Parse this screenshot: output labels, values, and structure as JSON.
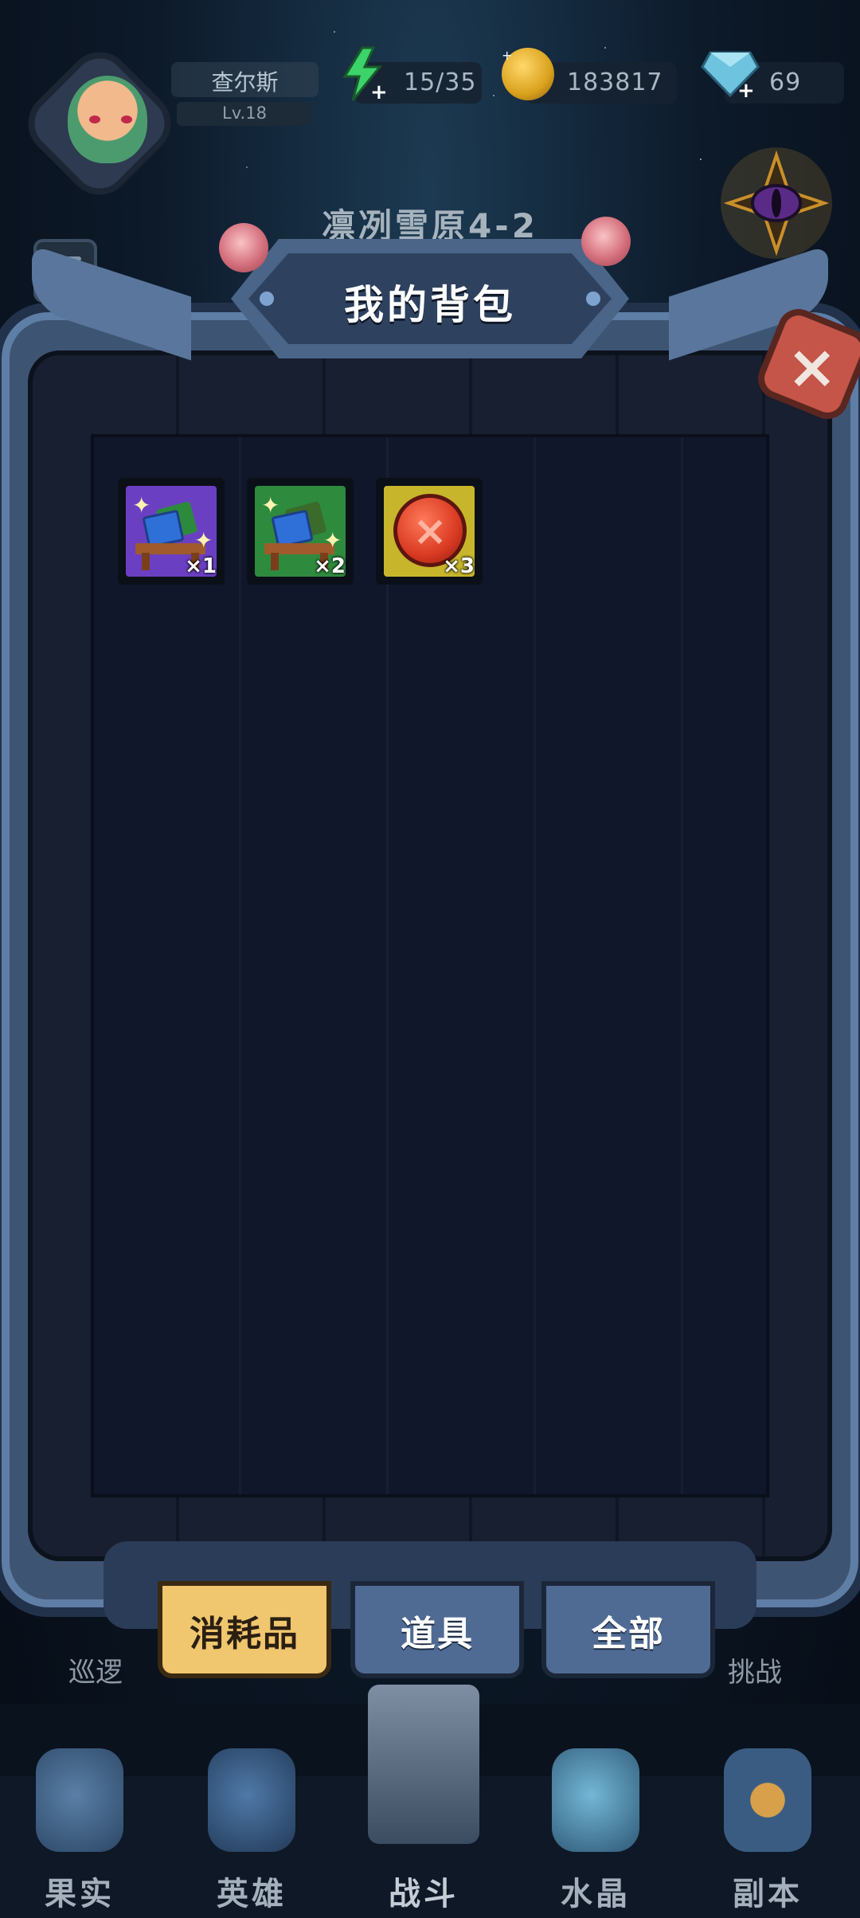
{
  "player": {
    "name": "查尔斯",
    "level": "Lv.18"
  },
  "resources": {
    "energy": "15/35",
    "gold": "183817",
    "diamonds": "69"
  },
  "stage": {
    "title": "凛冽雪原4-2"
  },
  "panel": {
    "title": "我的背包",
    "close_symbol": "×"
  },
  "items": [
    {
      "name": "purple-book-desk",
      "rarity_color": "#6b3fc2",
      "count": "×1"
    },
    {
      "name": "green-book-desk",
      "rarity_color": "#2e8a3d",
      "count": "×2"
    },
    {
      "name": "red-medal",
      "rarity_color": "#c7b62b",
      "count": "×3"
    }
  ],
  "tabs": [
    {
      "label": "消耗品",
      "active": true
    },
    {
      "label": "道具",
      "active": false
    },
    {
      "label": "全部",
      "active": false
    }
  ],
  "side_labels": {
    "left": "巡逻",
    "right": "挑战"
  },
  "nav": [
    {
      "label": "果实",
      "icon": "fruit-icon"
    },
    {
      "label": "英雄",
      "icon": "hero-icon"
    },
    {
      "label": "战斗",
      "icon": "battle-icon"
    },
    {
      "label": "水晶",
      "icon": "crystal-icon"
    },
    {
      "label": "副本",
      "icon": "dungeon-icon"
    }
  ],
  "colors": {
    "active_tab": "#f0c66e",
    "idle_tab": "#4f6b94",
    "panel_frame": "#3e5473",
    "close_button": "#c45548"
  }
}
